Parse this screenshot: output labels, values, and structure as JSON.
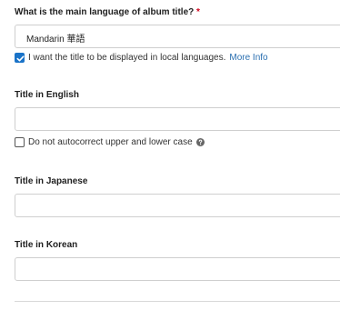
{
  "main_language": {
    "label": "What is the main language of album title?",
    "required_marker": "*",
    "selected_value": "Mandarin 華語"
  },
  "display_local": {
    "checked": true,
    "label": "I want the title to be displayed in local languages.",
    "more_info_link": "More Info"
  },
  "title_english": {
    "label": "Title in English",
    "value": ""
  },
  "autocorrect": {
    "checked": false,
    "label": "Do not autocorrect upper and lower case",
    "help_icon": "question-circle-icon"
  },
  "title_japanese": {
    "label": "Title in Japanese",
    "value": ""
  },
  "title_korean": {
    "label": "Title in Korean",
    "value": ""
  },
  "colors": {
    "accent": "#1a73c8",
    "link": "#2a6fb0",
    "required": "#d0021b",
    "border": "#cfcfcf"
  }
}
